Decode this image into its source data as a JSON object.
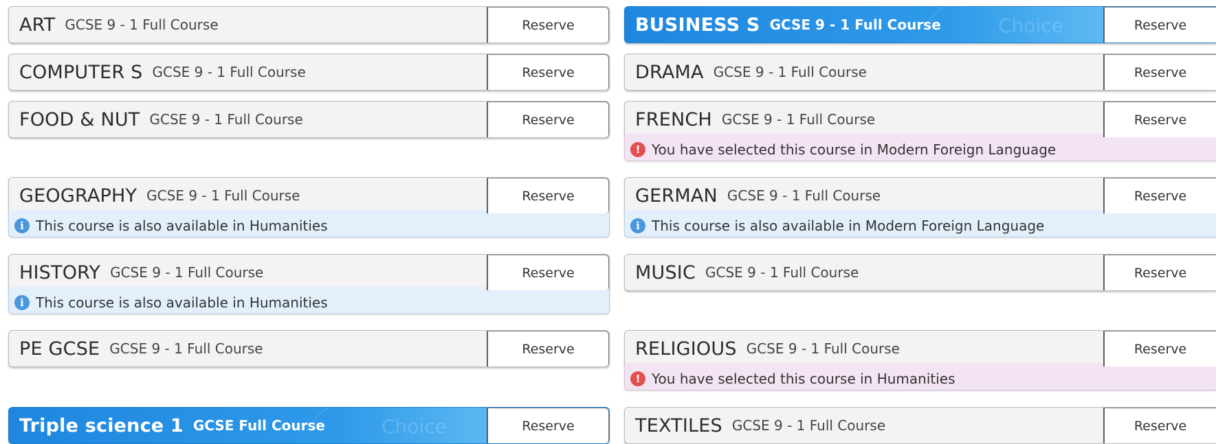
{
  "reserve_label": "Reserve",
  "watermark": "Choice",
  "colors": {
    "selected_start": "#1f86df",
    "selected_end": "#6cc3f4",
    "info_bg": "#e3f0fc",
    "warn_bg": "#f3e4f3",
    "info_icon": "#4a97dd",
    "warn_icon": "#e05050"
  },
  "icons": {
    "info": "info-circle-icon",
    "warning": "exclamation-circle-icon"
  },
  "left": [
    {
      "title": "ART",
      "subtitle": "GCSE 9 - 1 Full Course"
    },
    {
      "title": "COMPUTER S",
      "subtitle": "GCSE 9 - 1 Full Course"
    },
    {
      "title": "FOOD & NUT",
      "subtitle": "GCSE 9 - 1 Full Course"
    },
    {
      "title": "GEOGRAPHY",
      "subtitle": "GCSE 9 - 1 Full Course",
      "note": "This course is also available in Humanities"
    },
    {
      "title": "HISTORY",
      "subtitle": "GCSE 9 - 1 Full Course",
      "note": "This course is also available in Humanities"
    },
    {
      "title": "PE GCSE",
      "subtitle": "GCSE 9 - 1 Full Course"
    },
    {
      "title": "Triple science 1",
      "subtitle": "GCSE Full Course"
    }
  ],
  "right": [
    {
      "title": "BUSINESS S",
      "subtitle": "GCSE 9 - 1 Full Course"
    },
    {
      "title": "DRAMA",
      "subtitle": "GCSE 9 - 1 Full Course"
    },
    {
      "title": "FRENCH",
      "subtitle": "GCSE 9 - 1 Full Course",
      "note": "You have selected this course in Modern Foreign Language"
    },
    {
      "title": "GERMAN",
      "subtitle": "GCSE 9 - 1 Full Course",
      "note": "This course is also available in Modern Foreign Language"
    },
    {
      "title": "MUSIC",
      "subtitle": "GCSE 9 - 1 Full Course"
    },
    {
      "title": "RELIGIOUS",
      "subtitle": "GCSE 9 - 1 Full Course",
      "note": "You have selected this course in Humanities"
    },
    {
      "title": "TEXTILES",
      "subtitle": "GCSE 9 - 1 Full Course"
    }
  ]
}
